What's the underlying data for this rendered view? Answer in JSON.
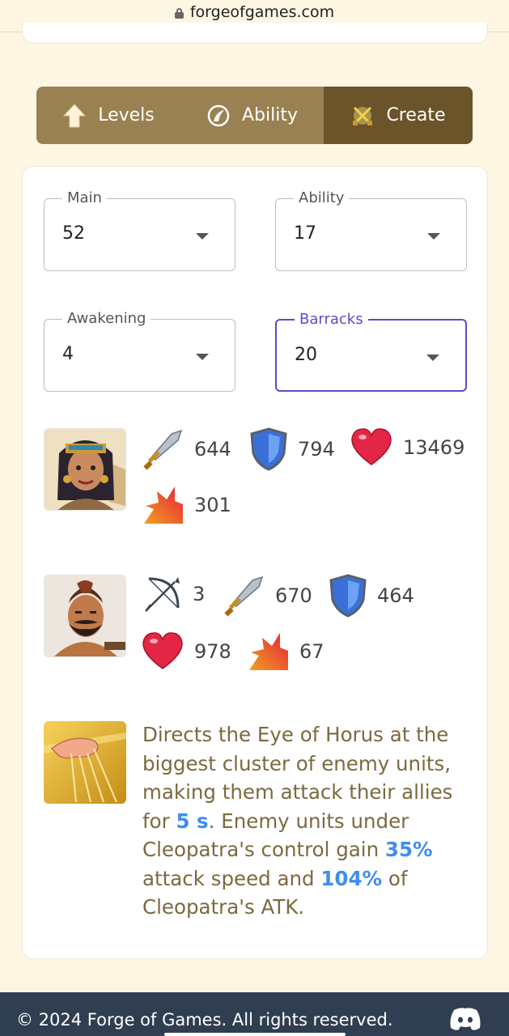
{
  "browser": {
    "url": "forgeofgames.com"
  },
  "tabs": [
    {
      "label": "Levels",
      "icon": "up-arrow-icon"
    },
    {
      "label": "Ability",
      "icon": "ability-icon"
    },
    {
      "label": "Create",
      "icon": "crossed-swords-icon",
      "active": true
    }
  ],
  "fields": {
    "main": {
      "label": "Main",
      "value": "52"
    },
    "ability": {
      "label": "Ability",
      "value": "17"
    },
    "awakening": {
      "label": "Awakening",
      "value": "4"
    },
    "barracks": {
      "label": "Barracks",
      "value": "20",
      "focused": true
    }
  },
  "hero": {
    "name_icon": "cleopatra-portrait",
    "attack": "644",
    "defense": "794",
    "health": "13469",
    "damage": "301"
  },
  "unit": {
    "name_icon": "unit-portrait",
    "range": "3",
    "attack": "670",
    "defense": "464",
    "health": "978",
    "damage": "67"
  },
  "ability": {
    "icon": "eye-of-horus-hand-icon",
    "text_1": "Directs the Eye of Horus at the biggest cluster of enemy units, making them attack their allies for ",
    "duration": "5 s",
    "text_2": ". Enemy units under Cleopatra's control gain ",
    "speed": "35%",
    "text_3": " attack speed and ",
    "atk_pct": "104%",
    "text_4": " of Cleopatra's ATK."
  },
  "footer": {
    "copyright": "© 2024 Forge of Games. All rights reserved.",
    "social_icon": "discord-icon"
  },
  "colors": {
    "tab_bg": "#9a8151",
    "tab_active": "#6b532a",
    "focus": "#5b4bc9",
    "highlight": "#3d8ef0",
    "desc_text": "#7b6a3e",
    "footer_bg": "#2f3e50"
  }
}
